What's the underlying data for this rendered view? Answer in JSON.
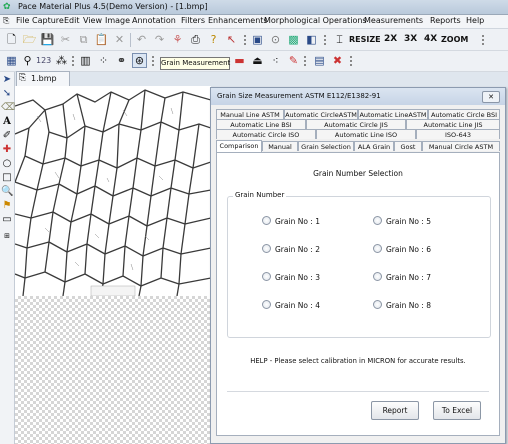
{
  "app": {
    "title": "Pace Material Plus 4.5(Demo Version) - [1.bmp]"
  },
  "menu": {
    "items": [
      "File",
      "Capture",
      "Edit",
      "View",
      "Image",
      "Annotation",
      "Filters",
      "Enhancements",
      "Morphological Operations",
      "Measurements",
      "Reports",
      "Help"
    ]
  },
  "toolbar": {
    "resize_label": "RESIZE",
    "zoom_2x": "2X",
    "zoom_3x": "3X",
    "zoom_4x": "4X",
    "zoom_label": "ZOOM",
    "tooltip": "Grain Measurement"
  },
  "document": {
    "tab_label": "1.bmp"
  },
  "dialog": {
    "title": "Grain Size Measurement ASTM E112/E1382-91",
    "close_label": "✕",
    "tab_rows": [
      [
        "Manual Line ASTM",
        "Automatic CircleASTM",
        "Automatic LineASTM",
        "Automatic Circle BSI"
      ],
      [
        "Automatic Line BSI",
        "Automatic Circle JIS",
        "Automatic Line JIS"
      ],
      [
        "Automatic Circle ISO",
        "Automatic Line ISO",
        "ISO-643"
      ],
      [
        "Comparison",
        "Manual",
        "Grain Selection",
        "ALA Grain",
        "Gost",
        "Manual Circle ASTM"
      ]
    ],
    "active_tab": "Comparison",
    "panel_heading": "Grain Number Selection",
    "group_label": "Grain Number",
    "grain_options": [
      "Grain No : 1",
      "Grain No : 5",
      "Grain No : 2",
      "Grain No : 6",
      "Grain No : 3",
      "Grain No : 7",
      "Grain No : 4",
      "Grain No : 8"
    ],
    "help_text": "HELP - Please select calibration in MICRON for accurate results.",
    "report_button": "Report",
    "excel_button": "To Excel"
  }
}
